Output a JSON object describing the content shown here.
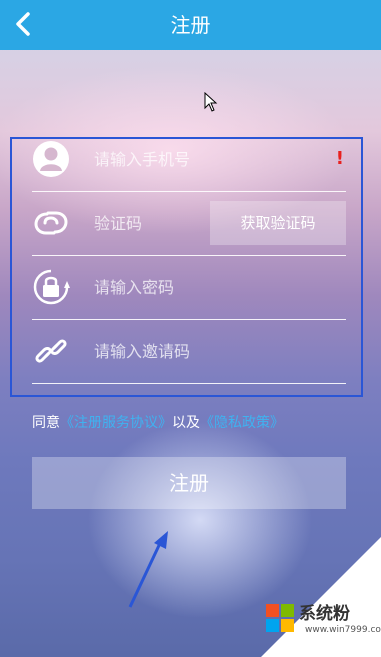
{
  "header": {
    "title": "注册",
    "back_icon": "chevron-left-icon"
  },
  "form": {
    "phone": {
      "placeholder": "请输入手机号",
      "icon": "user-icon",
      "warning": "!"
    },
    "code": {
      "placeholder": "验证码",
      "icon": "link-loop-icon",
      "button": "获取验证码"
    },
    "password": {
      "placeholder": "请输入密码",
      "icon": "lock-icon"
    },
    "invite": {
      "placeholder": "请输入邀请码",
      "icon": "chain-link-icon"
    }
  },
  "agreement": {
    "prefix": "同意",
    "terms": "《注册服务协议》",
    "middle": "以及",
    "privacy": "《隐私政策》"
  },
  "register_button": "注册",
  "watermark": {
    "text": "系统粉",
    "url": "www.win7999.com"
  },
  "colors": {
    "header": "#2ba7e4",
    "link": "#3fb2f0",
    "warning": "#e8201e",
    "highlight_box": "#2a56d6"
  }
}
